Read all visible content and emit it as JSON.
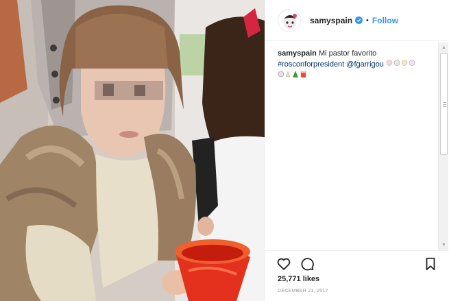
{
  "post": {
    "image_alt": "Child wearing a fur vest holding a red cup",
    "header": {
      "username": "samyspain",
      "separator": "•",
      "follow_label": "Follow"
    },
    "caption": {
      "username": "samyspain",
      "text": "Mi pastor favorito",
      "hashtag": "#rosconforpresident",
      "mention": "@fgarrigou"
    },
    "likes": "25,771 likes",
    "date": "DECEMBER 21, 2017"
  },
  "colors": {
    "accent": "#3897f0",
    "hashtag": "#003569",
    "text": "#262626",
    "muted": "#999999"
  },
  "icons": {
    "verified": "verified-badge-icon",
    "like": "heart-outline-icon",
    "comment": "speech-bubble-icon",
    "save": "bookmark-icon"
  }
}
